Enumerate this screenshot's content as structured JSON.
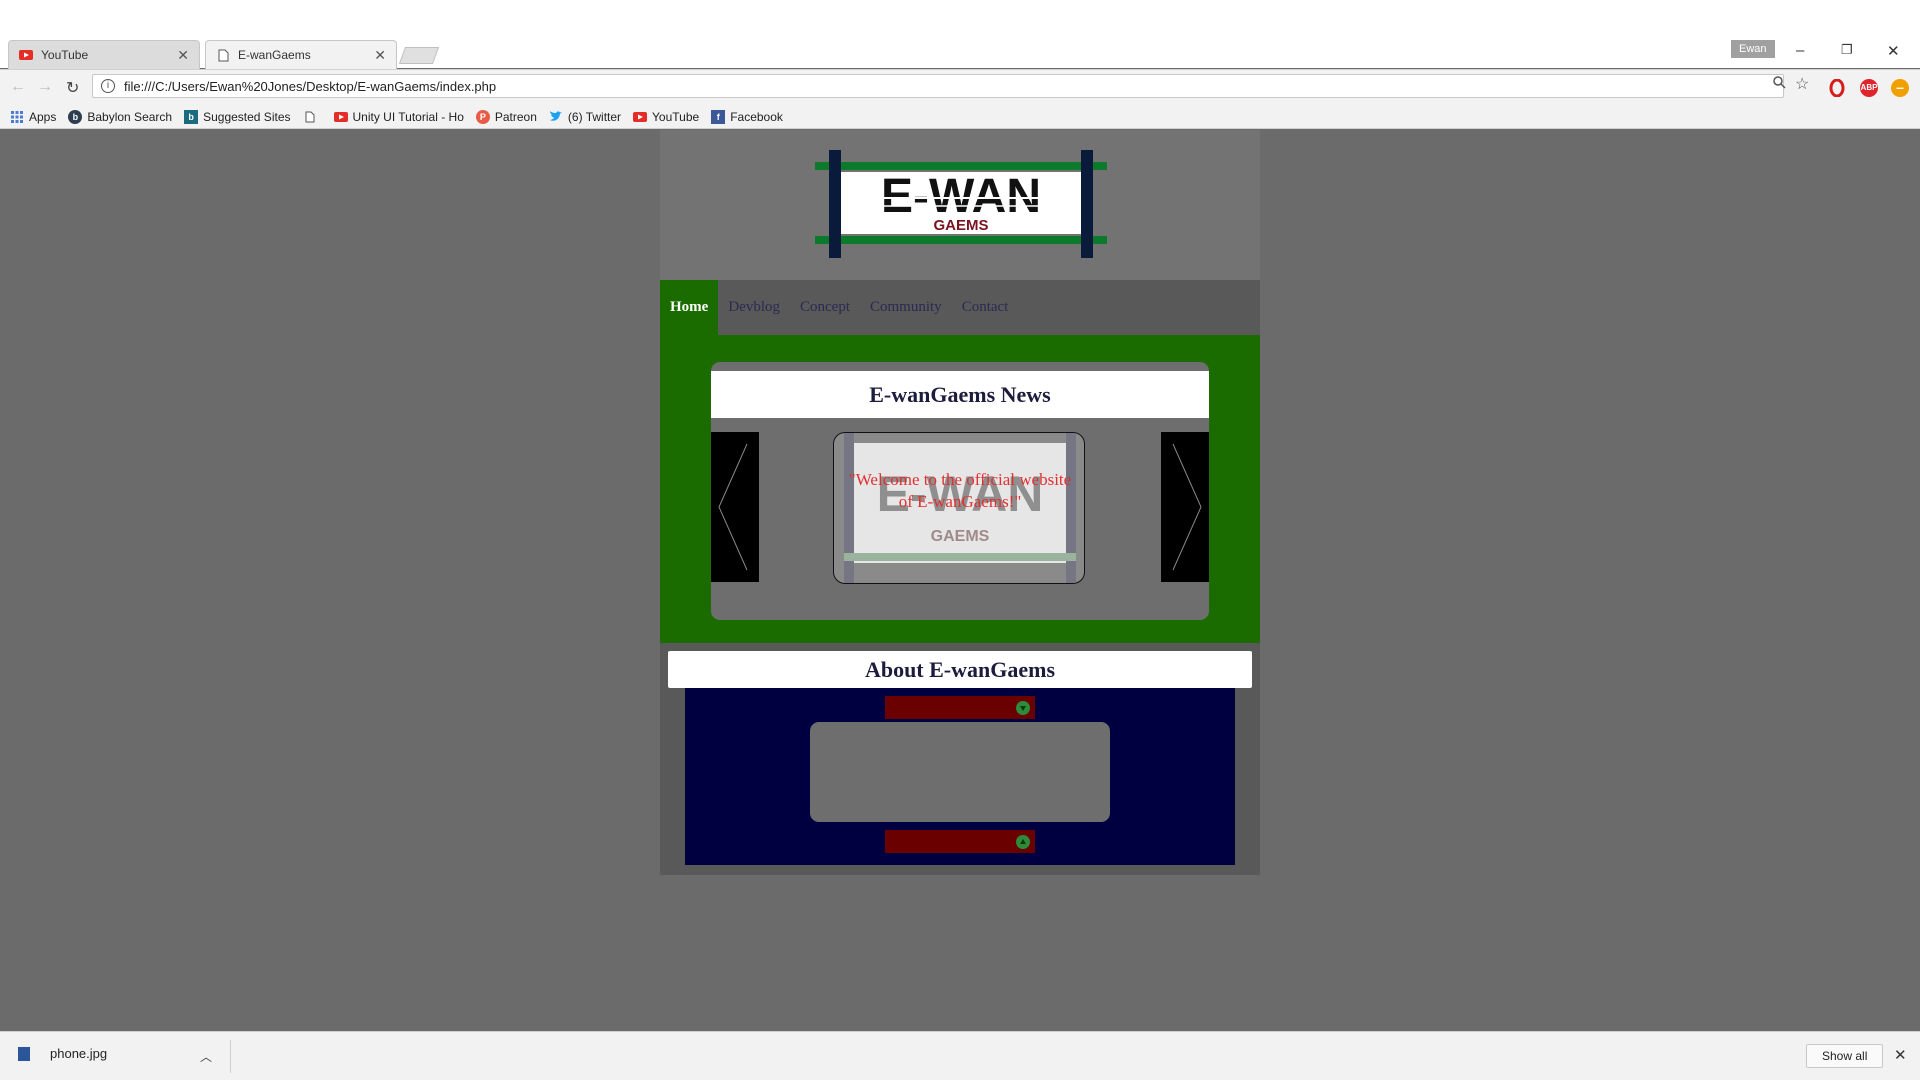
{
  "browser": {
    "tabs": [
      {
        "title": "YouTube",
        "icon": "youtube-icon"
      },
      {
        "title": "E-wanGaems",
        "icon": "page-icon"
      }
    ],
    "profile": "Ewan",
    "url": "file:///C:/Users/Ewan%20Jones/Desktop/E-wanGaems/index.php",
    "bookmarks": [
      {
        "label": "Apps",
        "icon": "apps-icon"
      },
      {
        "label": "Babylon Search",
        "icon": "babylon-icon"
      },
      {
        "label": "Suggested Sites",
        "icon": "bing-icon"
      },
      {
        "label": "",
        "icon": "page-icon"
      },
      {
        "label": "Unity UI Tutorial - Ho",
        "icon": "youtube-icon"
      },
      {
        "label": "Patreon",
        "icon": "patreon-icon"
      },
      {
        "label": "(6) Twitter",
        "icon": "twitter-icon"
      },
      {
        "label": "YouTube",
        "icon": "youtube-icon"
      },
      {
        "label": "Facebook",
        "icon": "facebook-icon"
      }
    ],
    "extensions": [
      {
        "name": "opera-icon",
        "text": "",
        "color": "#d81b1b"
      },
      {
        "name": "adblock-icon",
        "text": "ABP",
        "color": "#e0242c"
      },
      {
        "name": "minus-extension-icon",
        "text": "–",
        "color": "#f0a000"
      }
    ]
  },
  "site": {
    "logo": {
      "main": "E-WAN",
      "sub": "GAEMS"
    },
    "nav": [
      "Home",
      "Devblog",
      "Concept",
      "Community",
      "Contact"
    ],
    "active_nav": "Home",
    "news": {
      "title": "E-wanGaems News",
      "slide_text": "\"Welcome to the official website of E-wanGaems!\""
    },
    "about": {
      "title": "About E-wanGaems"
    }
  },
  "download": {
    "file": "phone.jpg",
    "show_all": "Show all"
  },
  "colors": {
    "page_bg": "#6b6b6b",
    "news_bg": "#1a6b00",
    "about_panel": "#000040",
    "accent_red": "#e03030"
  }
}
